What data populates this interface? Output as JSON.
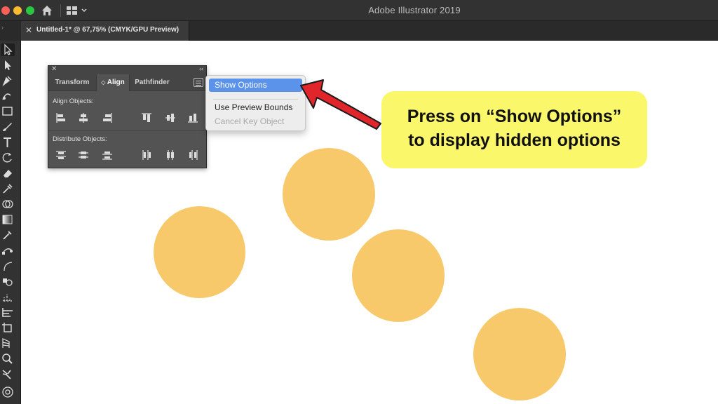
{
  "window": {
    "app_title": "Adobe Illustrator 2019"
  },
  "document_tab": {
    "label": "Untitled-1* @ 67,75% (CMYK/GPU Preview)",
    "close_glyph": "✕"
  },
  "toolbar": {
    "collapse_glyph": "›",
    "tools": [
      "selection-tool",
      "direct-selection-tool",
      "pen-tool",
      "curvature-tool",
      "rectangle-tool",
      "paintbrush-tool",
      "type-tool",
      "rotate-tool",
      "eraser-tool",
      "eyedropper-tool",
      "shape-builder-tool",
      "gradient-tool",
      "eyedropper-tool-2",
      "blend-tool",
      "curve-tool",
      "symbol-sprayer-tool",
      "column-graph-tool",
      "artboard-tool",
      "slice-tool",
      "perspective-grid-tool",
      "zoom-tool",
      "hand-tool",
      "drawing-modes"
    ]
  },
  "align_panel": {
    "close_glyph": "✕",
    "collapse_glyph": "‹‹",
    "tabs": [
      {
        "label": "Transform",
        "active": false
      },
      {
        "label": "Align",
        "active": true,
        "prefix": "◇"
      },
      {
        "label": "Pathfinder",
        "active": false
      }
    ],
    "align_objects_label": "Align Objects:",
    "distribute_objects_label": "Distribute Objects:"
  },
  "flyout_menu": {
    "items": [
      {
        "label": "Show Options",
        "highlighted": true
      },
      {
        "label": "Use Preview Bounds",
        "highlighted": false
      },
      {
        "label": "Cancel Key Object",
        "disabled": true
      }
    ]
  },
  "callout": {
    "line1": "Press on “Show Options”",
    "line2": "to display hidden options",
    "color": "#fbf76a"
  },
  "colors": {
    "circle_fill": "#f7c96a",
    "arrow_red": "#e0262b",
    "highlight_blue": "#5a93e9"
  }
}
